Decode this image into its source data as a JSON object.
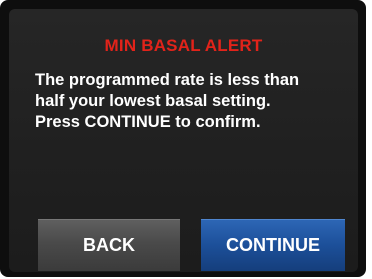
{
  "dialog": {
    "title": "MIN BASAL ALERT",
    "message_lines": [
      "The programmed rate is less than",
      "half your lowest basal setting.",
      "Press CONTINUE to confirm."
    ]
  },
  "buttons": {
    "back_label": "BACK",
    "continue_label": "CONTINUE"
  },
  "colors": {
    "title": "#e2231a",
    "screen_background": "#222222",
    "back_button": "#4a4a4a",
    "continue_button": "#1c4f99"
  }
}
